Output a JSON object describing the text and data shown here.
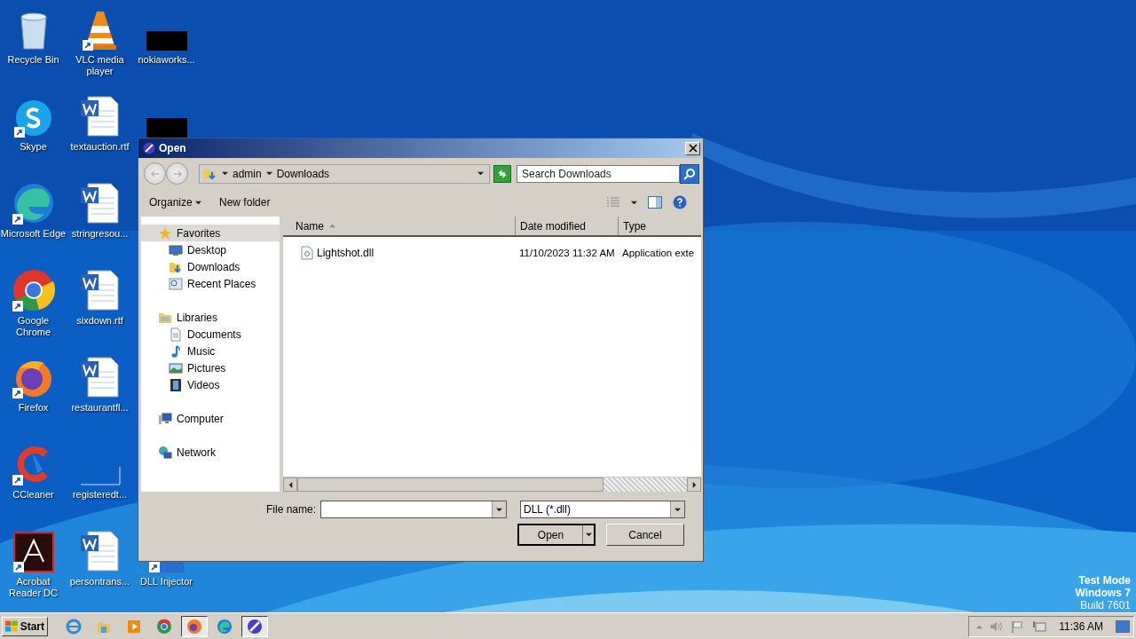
{
  "desktop": {
    "icons": [
      {
        "kind": "recycle-bin",
        "label": "Recycle Bin",
        "shortcut": false
      },
      {
        "kind": "skype",
        "label": "Skype",
        "shortcut": true
      },
      {
        "kind": "edge",
        "label": "Microsoft Edge",
        "shortcut": true
      },
      {
        "kind": "chrome",
        "label": "Google Chrome",
        "shortcut": true
      },
      {
        "kind": "firefox",
        "label": "Firefox",
        "shortcut": true
      },
      {
        "kind": "ccleaner",
        "label": "CCleaner",
        "shortcut": true
      },
      {
        "kind": "acrobat",
        "label": "Acrobat Reader DC",
        "shortcut": true
      },
      {
        "kind": "vlc",
        "label": "VLC media player",
        "shortcut": true
      },
      {
        "kind": "word",
        "label": "textauction.rtf",
        "shortcut": false
      },
      {
        "kind": "word",
        "label": "stringresou...",
        "shortcut": false
      },
      {
        "kind": "word",
        "label": "sixdown.rtf",
        "shortcut": false
      },
      {
        "kind": "word",
        "label": "restaurantfl...",
        "shortcut": false
      },
      {
        "kind": "blank",
        "label": "registeredt...",
        "shortcut": false
      },
      {
        "kind": "word",
        "label": "persontrans...",
        "shortcut": false
      },
      {
        "kind": "redacted",
        "label": "nokiaworks...",
        "shortcut": false
      },
      {
        "kind": "redacted",
        "shortcut": false
      },
      {
        "kind": "injector",
        "label": "DLL Injector",
        "shortcut": true
      }
    ]
  },
  "dialog": {
    "title": "Open",
    "breadcrumb": [
      "admin",
      "Downloads"
    ],
    "search": {
      "placeholder": "Search Downloads"
    },
    "commands": [
      "Organize",
      "New folder"
    ],
    "nav": [
      {
        "label": "Favorites",
        "kind": "star",
        "selected": true,
        "children": [
          {
            "label": "Desktop",
            "kind": "desktop",
            "selected": false
          },
          {
            "label": "Downloads",
            "kind": "downloads",
            "selected": false
          },
          {
            "label": "Recent Places",
            "kind": "recent",
            "selected": false
          }
        ]
      },
      {
        "label": "Libraries",
        "kind": "libraries",
        "selected": false,
        "children": [
          {
            "label": "Documents",
            "kind": "documents",
            "selected": false
          },
          {
            "label": "Music",
            "kind": "music",
            "selected": false
          },
          {
            "label": "Pictures",
            "kind": "pictures",
            "selected": false
          },
          {
            "label": "Videos",
            "kind": "videos",
            "selected": false
          }
        ]
      },
      {
        "label": "Computer",
        "kind": "computer",
        "selected": false
      },
      {
        "label": "Network",
        "kind": "network",
        "selected": false
      }
    ],
    "columns": [
      {
        "label": "Name",
        "sorted": true
      },
      {
        "label": "Date modified",
        "sorted": false
      },
      {
        "label": "Type",
        "sorted": false
      }
    ],
    "files": [
      {
        "name": "Lightshot.dll",
        "date": "11/10/2023 11:32 AM",
        "type": "Application exte"
      }
    ],
    "file_name_label": "File name:",
    "filter": "DLL (*.dll)",
    "open_button": "Open",
    "cancel_button": "Cancel"
  },
  "os_notice": [
    "Test Mode",
    "Windows 7",
    "Build 7601"
  ],
  "taskbar": {
    "start": "Start",
    "apps": [
      {
        "kind": "ie",
        "active": false
      },
      {
        "kind": "explorer",
        "active": false
      },
      {
        "kind": "media",
        "active": false
      },
      {
        "kind": "chrome",
        "active": false
      },
      {
        "kind": "firefox",
        "active": true
      },
      {
        "kind": "edge",
        "active": false
      },
      {
        "kind": "injector",
        "active": true
      }
    ],
    "clock": "11:36 AM"
  }
}
